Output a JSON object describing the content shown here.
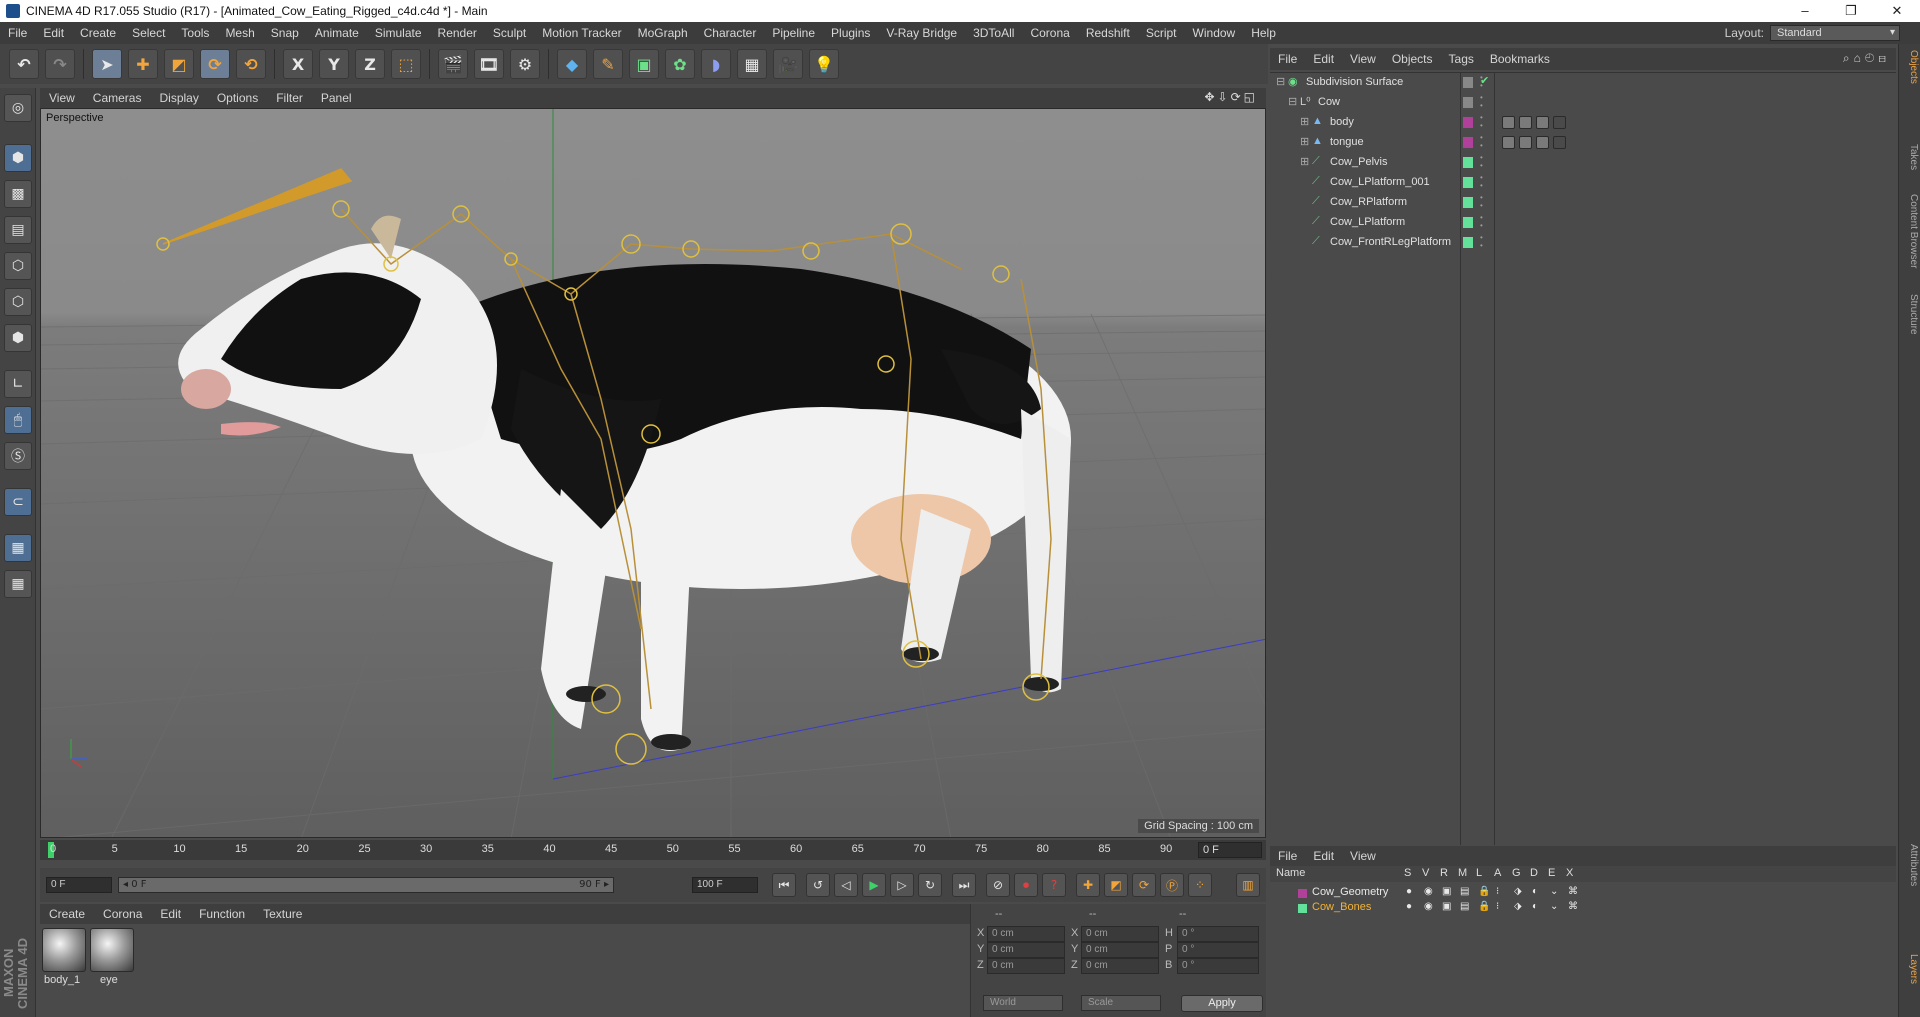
{
  "window": {
    "title": "CINEMA 4D R17.055 Studio (R17) - [Animated_Cow_Eating_Rigged_c4d.c4d *] - Main",
    "controls": [
      "–",
      "❐",
      "✕"
    ]
  },
  "menubar": {
    "items": [
      "File",
      "Edit",
      "Create",
      "Select",
      "Tools",
      "Mesh",
      "Snap",
      "Animate",
      "Simulate",
      "Render",
      "Sculpt",
      "Motion Tracker",
      "MoGraph",
      "Character",
      "Pipeline",
      "Plugins",
      "V-Ray Bridge",
      "3DToAll",
      "Corona",
      "Redshift",
      "Script",
      "Window",
      "Help"
    ],
    "layout_label": "Layout:",
    "layout_value": "Standard"
  },
  "toolbar": {
    "axis_x": "X",
    "axis_y": "Y",
    "axis_z": "Z"
  },
  "viewport": {
    "menu": [
      "View",
      "Cameras",
      "Display",
      "Options",
      "Filter",
      "Panel"
    ],
    "label": "Perspective",
    "grid_spacing": "Grid Spacing : 100 cm",
    "nav_icons": "✥⇩⟳◱"
  },
  "timeline": {
    "ticks": [
      "0",
      "5",
      "10",
      "15",
      "20",
      "25",
      "30",
      "35",
      "40",
      "45",
      "50",
      "55",
      "60",
      "65",
      "70",
      "75",
      "80",
      "85",
      "90"
    ],
    "current_frame": "0 F",
    "start_field": "0 F",
    "range_start": "◂ 0 F",
    "range_end": "90 F ▸",
    "end_field": "100 F"
  },
  "materials": {
    "menu": [
      "Create",
      "Corona",
      "Edit",
      "Function",
      "Texture"
    ],
    "items": [
      {
        "name": "body_1"
      },
      {
        "name": "eye"
      }
    ]
  },
  "coordinates": {
    "header": [
      "--",
      "--",
      "--"
    ],
    "rows": [
      {
        "a": "X",
        "av": "0 cm",
        "b": "X",
        "bv": "0 cm",
        "c": "H",
        "cv": "0 °"
      },
      {
        "a": "Y",
        "av": "0 cm",
        "b": "Y",
        "bv": "0 cm",
        "c": "P",
        "cv": "0 °"
      },
      {
        "a": "Z",
        "av": "0 cm",
        "b": "Z",
        "bv": "0 cm",
        "c": "B",
        "cv": "0 °"
      }
    ],
    "mode": "World",
    "scale": "Scale",
    "apply": "Apply"
  },
  "objects": {
    "menu": [
      "File",
      "Edit",
      "View",
      "Objects",
      "Tags",
      "Bookmarks"
    ],
    "rows": [
      {
        "name": "Subdivision Surface",
        "indent": 0,
        "color": "#888888",
        "icon": "subdivision-icon",
        "expand": "⊟"
      },
      {
        "name": "Cow",
        "indent": 1,
        "color": "#888888",
        "icon": "null-icon",
        "expand": "⊟"
      },
      {
        "name": "body",
        "indent": 2,
        "color": "#b0409a",
        "icon": "polygon-icon",
        "expand": "⊞"
      },
      {
        "name": "tongue",
        "indent": 2,
        "color": "#b0409a",
        "icon": "polygon-icon",
        "expand": "⊞"
      },
      {
        "name": "Cow_Pelvis",
        "indent": 2,
        "color": "#63e09a",
        "icon": "joint-icon",
        "expand": "⊞"
      },
      {
        "name": "Cow_LPlatform_001",
        "indent": 2,
        "color": "#63e09a",
        "icon": "joint-icon",
        "expand": ""
      },
      {
        "name": "Cow_RPlatform",
        "indent": 2,
        "color": "#63e09a",
        "icon": "joint-icon",
        "expand": ""
      },
      {
        "name": "Cow_LPlatform",
        "indent": 2,
        "color": "#63e09a",
        "icon": "joint-icon",
        "expand": ""
      },
      {
        "name": "Cow_FrontRLegPlatform",
        "indent": 2,
        "color": "#63e09a",
        "icon": "joint-icon",
        "expand": ""
      }
    ]
  },
  "sidetabs": [
    "Objects",
    "Takes",
    "Content Browser",
    "Structure",
    "Attributes",
    "Layers"
  ],
  "layers": {
    "menu": [
      "File",
      "Edit",
      "View"
    ],
    "columns": [
      "Name",
      "S",
      "V",
      "R",
      "M",
      "L",
      "A",
      "G",
      "D",
      "E",
      "X"
    ],
    "rows": [
      {
        "name": "Cow_Geometry",
        "color": "#b0409a",
        "text_color": "#e8e8e8"
      },
      {
        "name": "Cow_Bones",
        "color": "#63e09a",
        "text_color": "#f2b233"
      }
    ]
  },
  "branding": "MAXON CINEMA 4D"
}
